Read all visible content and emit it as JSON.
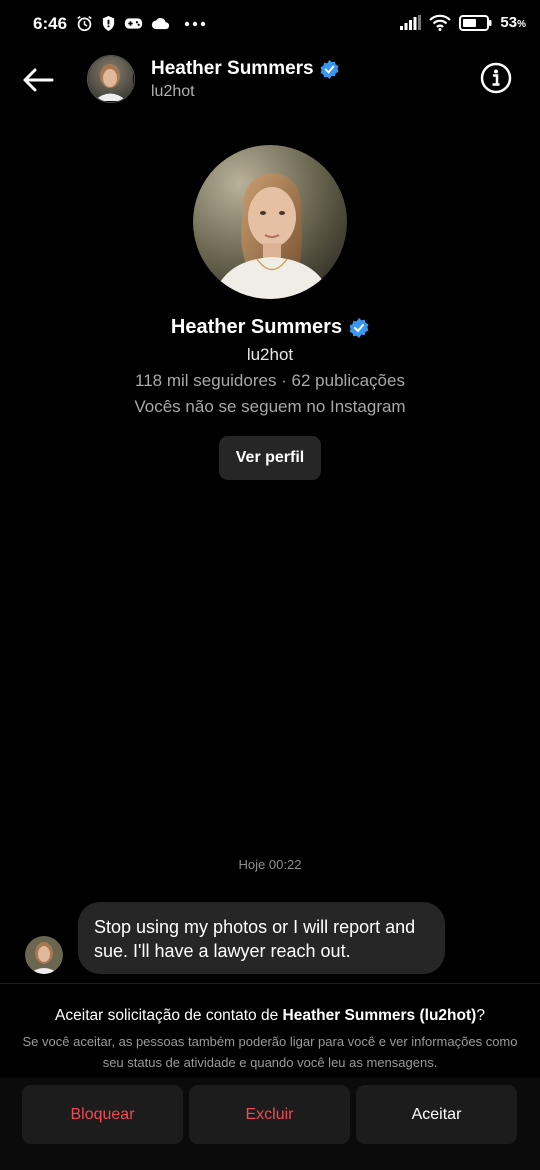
{
  "status_bar": {
    "time": "6:46",
    "battery": "53",
    "battery_unit": "%"
  },
  "header": {
    "name": "Heather Summers",
    "handle": "lu2hot",
    "verified": true
  },
  "profile": {
    "name": "Heather Summers",
    "handle": "lu2hot",
    "stats": "118 mil seguidores · 62 publicações",
    "follow_status": "Vocês não se seguem no Instagram",
    "view_profile_label": "Ver perfil"
  },
  "chat": {
    "timestamp": "Hoje 00:22",
    "message": "Stop using my photos or I will report and sue. I'll have a lawyer reach out."
  },
  "request": {
    "title_prefix": "Aceitar solicitação de contato de ",
    "title_name": "Heather Summers (lu2hot)",
    "title_suffix": "?",
    "description": "Se você aceitar, as pessoas também poderão ligar para você e ver informações como seu status de atividade e quando você leu as mensagens."
  },
  "actions": {
    "block_label": "Bloquear",
    "delete_label": "Excluir",
    "accept_label": "Aceitar"
  },
  "colors": {
    "background": "#000000",
    "bubble": "#262626",
    "danger": "#ed4956",
    "verified": "#3897f0"
  }
}
